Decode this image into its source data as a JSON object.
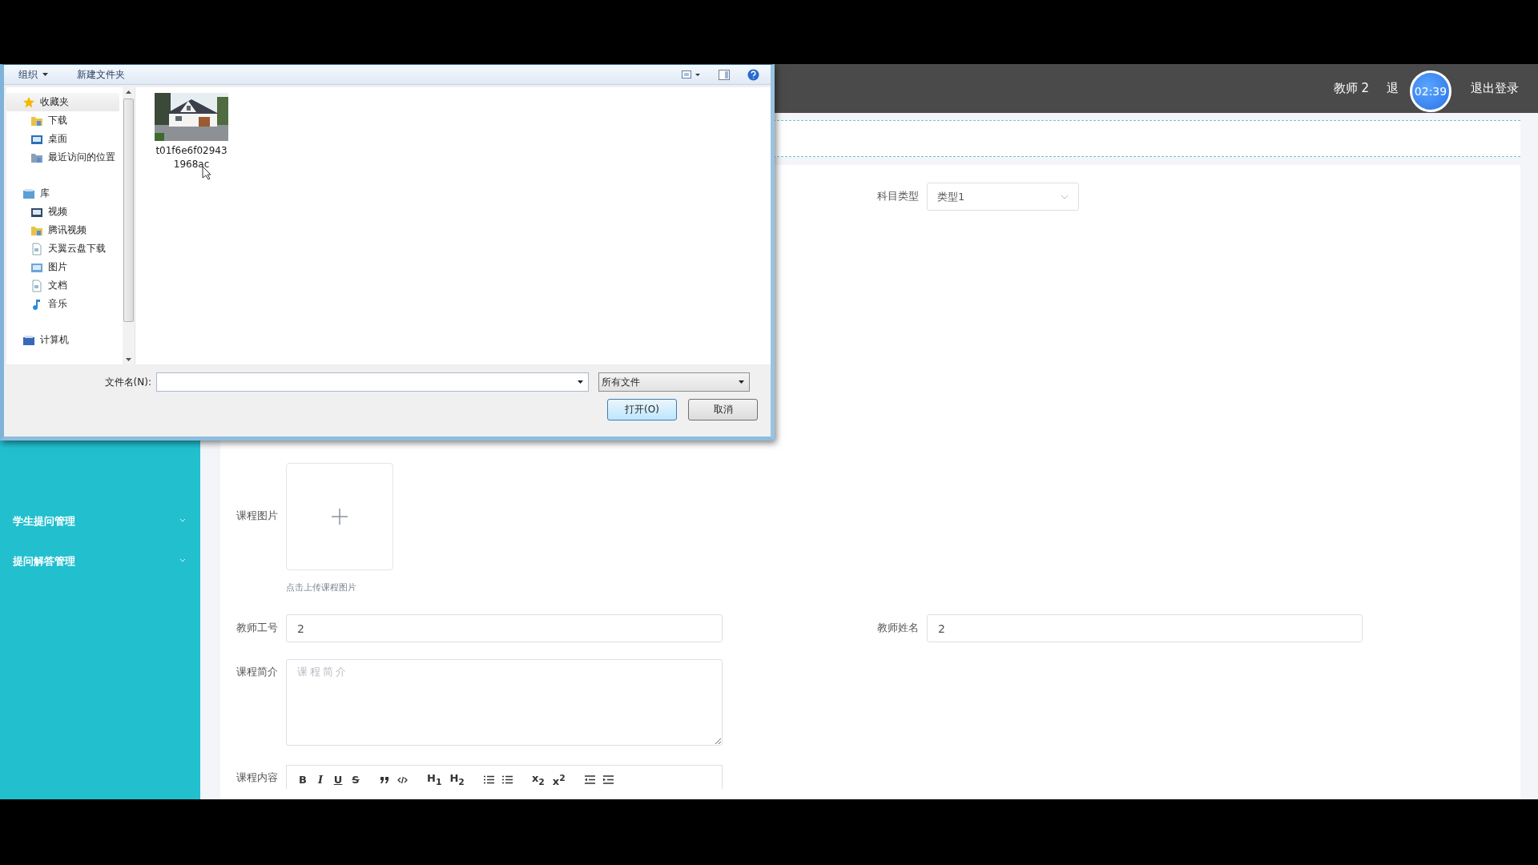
{
  "header": {
    "user": "教师 2",
    "partial_link": "退",
    "timer": "02:39",
    "logout": "退出登录"
  },
  "sidebar": {
    "items": [
      {
        "label": "学生提问管理"
      },
      {
        "label": "提问解答管理"
      }
    ]
  },
  "form": {
    "subject_type": {
      "label": "科目类型",
      "value": "类型1"
    },
    "course_image": {
      "label": "课程图片",
      "hint": "点击上传课程图片"
    },
    "teacher_id": {
      "label": "教师工号",
      "value": "2"
    },
    "teacher_name": {
      "label": "教师姓名",
      "value": "2"
    },
    "course_intro": {
      "label": "课程简介",
      "placeholder": "课程简介"
    },
    "course_content": {
      "label": "课程内容",
      "toolbar": [
        {
          "kind": "bold",
          "label": "B"
        },
        {
          "kind": "italic",
          "label": "I"
        },
        {
          "kind": "underline",
          "label": "U"
        },
        {
          "kind": "strike",
          "label": "S"
        },
        {
          "kind": "quote"
        },
        {
          "kind": "code"
        },
        {
          "kind": "heading",
          "label": "H$_{1}$"
        },
        {
          "kind": "heading",
          "label": "H$_{2}$"
        },
        {
          "kind": "ordered-list"
        },
        {
          "kind": "bullet-list"
        },
        {
          "kind": "script",
          "label": "x$_{2}$"
        },
        {
          "kind": "script",
          "label": "x$^{2}$"
        },
        {
          "kind": "outdent"
        },
        {
          "kind": "indent"
        }
      ]
    }
  },
  "dialog": {
    "toolbar": {
      "organize": "组织",
      "new_folder": "新建文件夹"
    },
    "nav": [
      {
        "label": "收藏夹",
        "kind": "star",
        "selected": true,
        "children": [
          {
            "label": "下载",
            "kind": "download",
            "selected": false
          },
          {
            "label": "桌面",
            "kind": "desktop",
            "selected": false
          },
          {
            "label": "最近访问的位置",
            "kind": "recent",
            "selected": false
          }
        ]
      },
      {
        "label": "库",
        "kind": "library",
        "selected": false,
        "children": [
          {
            "label": "视频",
            "kind": "video",
            "selected": false
          },
          {
            "label": "腾讯视频",
            "kind": "folder",
            "selected": false
          },
          {
            "label": "天翼云盘下载",
            "kind": "doc",
            "selected": false
          },
          {
            "label": "图片",
            "kind": "pictures",
            "selected": false
          },
          {
            "label": "文档",
            "kind": "doc",
            "selected": false
          },
          {
            "label": "音乐",
            "kind": "music",
            "selected": false
          }
        ]
      },
      {
        "label": "计算机",
        "kind": "computer",
        "selected": false
      }
    ],
    "files": [
      {
        "name": "t01f6e6f029431968ac",
        "kind": "picture"
      }
    ],
    "filename": {
      "label": "文件名(N):"
    },
    "filter": "所有文件",
    "buttons": [
      {
        "label": "打开(O)",
        "kind": "primary"
      },
      {
        "label": "取消",
        "kind": "normal"
      }
    ]
  }
}
